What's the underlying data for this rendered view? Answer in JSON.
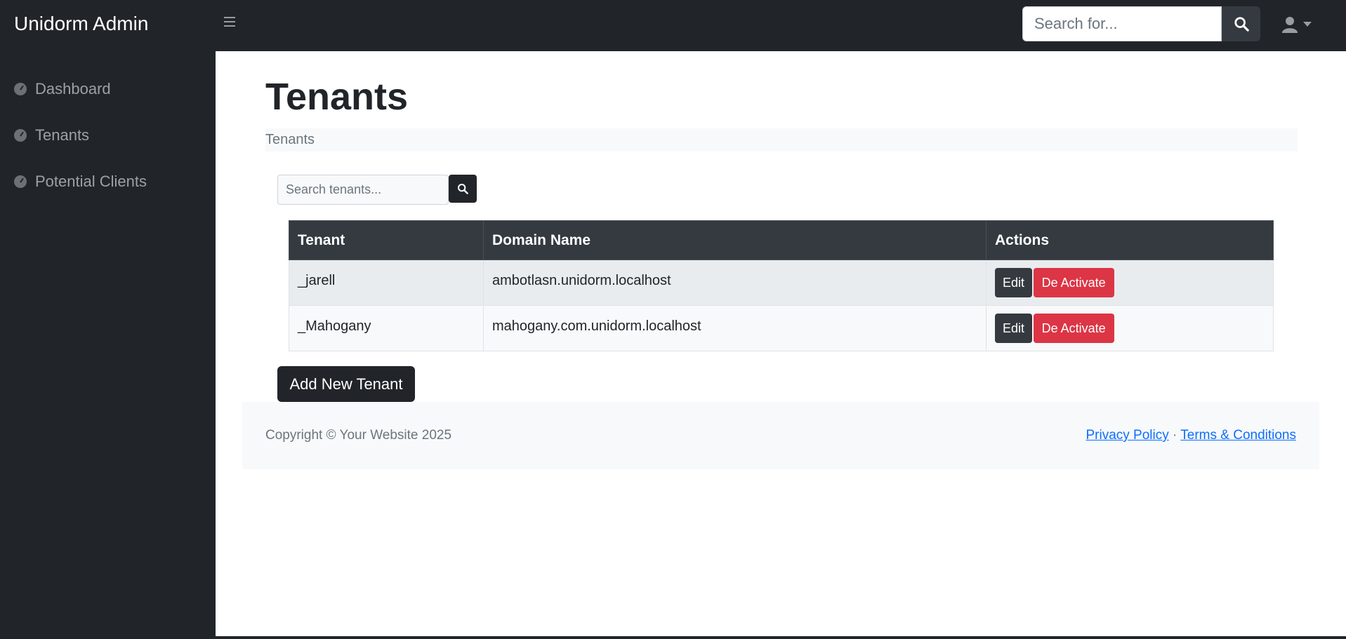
{
  "app": {
    "brand": "Unidorm Admin"
  },
  "topbar": {
    "search_placeholder": "Search for..."
  },
  "sidebar": {
    "items": [
      {
        "label": "Dashboard",
        "icon": "tachometer-icon"
      },
      {
        "label": "Tenants",
        "icon": "tachometer-icon"
      },
      {
        "label": "Potential Clients",
        "icon": "tachometer-icon"
      }
    ]
  },
  "main": {
    "title": "Tenants",
    "breadcrumb": "Tenants",
    "search_placeholder": "Search tenants...",
    "table": {
      "headers": [
        "Tenant",
        "Domain Name",
        "Actions"
      ],
      "rows": [
        {
          "tenant": "_jarell",
          "domain": "ambotlasn.unidorm.localhost",
          "edit": "Edit",
          "deactivate": "De Activate"
        },
        {
          "tenant": "_Mahogany",
          "domain": "mahogany.com.unidorm.localhost",
          "edit": "Edit",
          "deactivate": "De Activate"
        }
      ]
    },
    "add_button": "Add New Tenant"
  },
  "footer": {
    "copyright": "Copyright © Your Website 2025",
    "privacy": "Privacy Policy",
    "separator": "·",
    "terms": "Terms & Conditions"
  },
  "colors": {
    "dark": "#212529",
    "danger": "#dc3545",
    "link": "#0d6efd",
    "light": "#f8f9fa"
  }
}
